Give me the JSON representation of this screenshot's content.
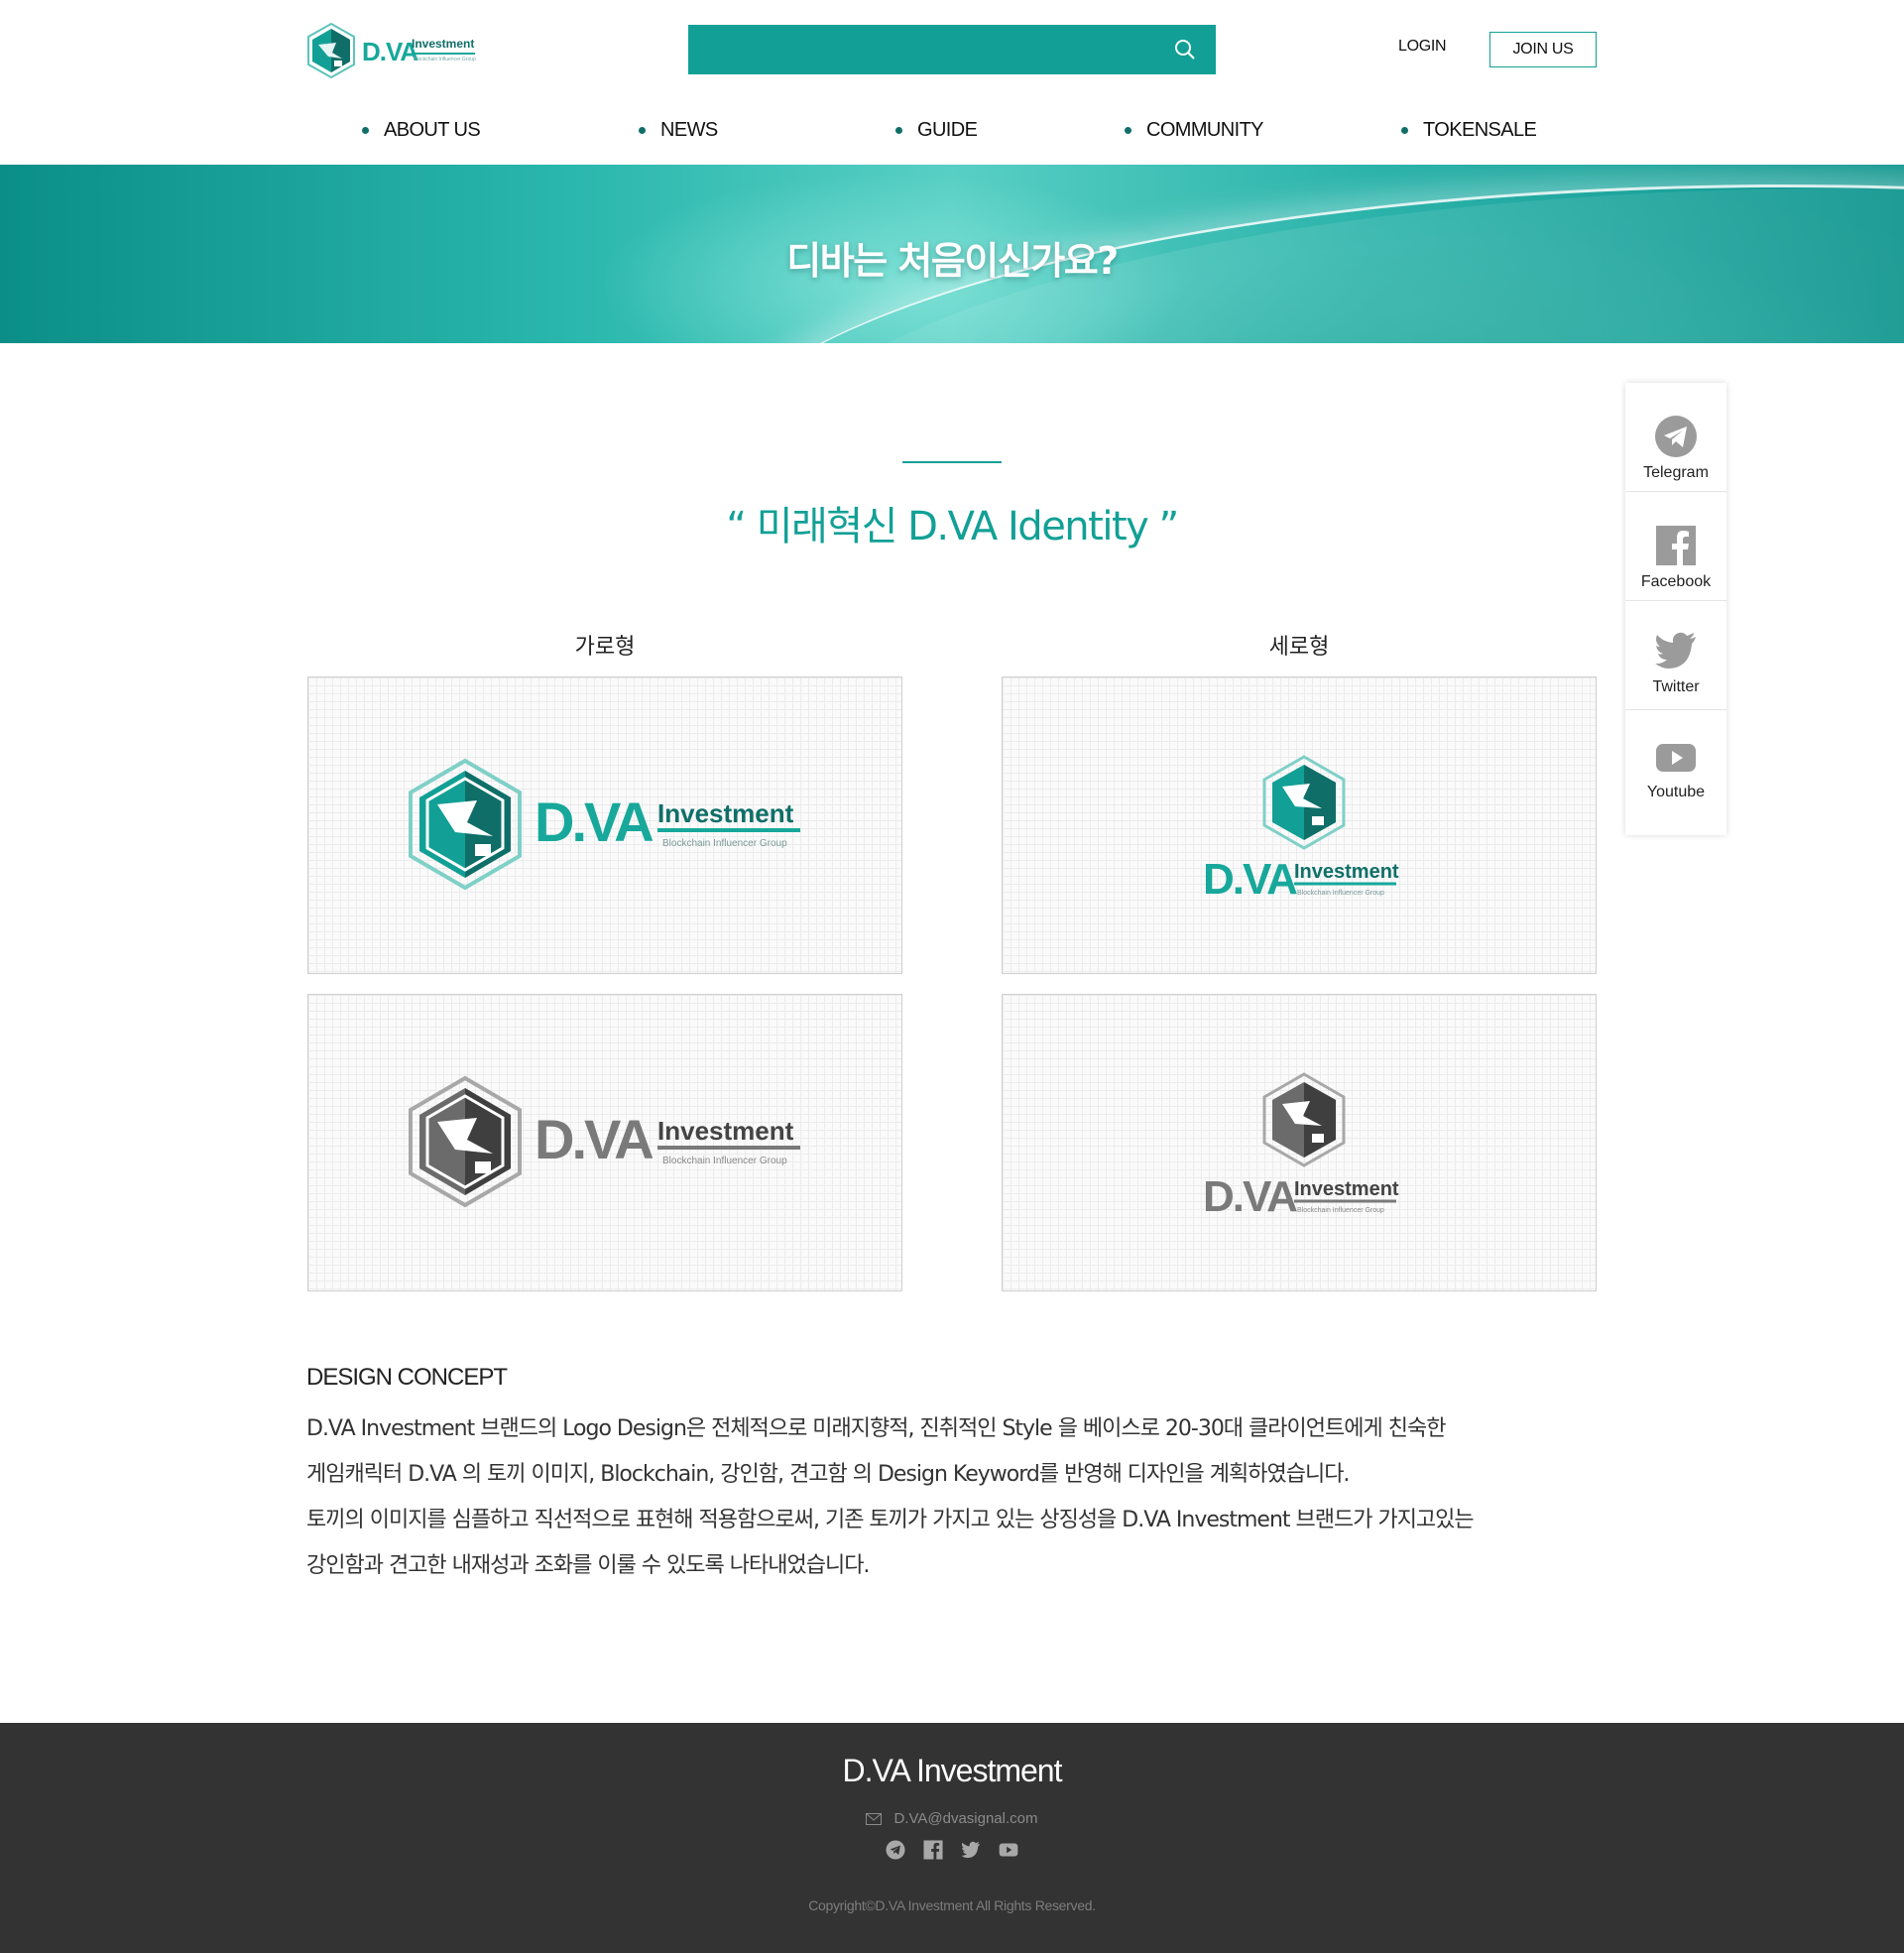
{
  "header": {
    "logo": {
      "brand": "D.VA",
      "product": "Investment",
      "tagline": "Blockchain Influencer Group"
    },
    "search": {
      "value": "",
      "placeholder": ""
    },
    "login_label": "LOGIN",
    "join_label": "JOIN US",
    "nav": [
      {
        "label": "ABOUT US"
      },
      {
        "label": "NEWS"
      },
      {
        "label": "GUIDE"
      },
      {
        "label": "COMMUNITY"
      },
      {
        "label": "TOKENSALE"
      }
    ]
  },
  "banner": {
    "title": "디바는 처음이신가요?"
  },
  "identity": {
    "title": "“ 미래혁신 D.VA Identity ”",
    "columns": [
      {
        "label": "가로형"
      },
      {
        "label": "세로형"
      }
    ],
    "logo_text": {
      "brand": "D.VA",
      "product": "Investment",
      "tagline": "Blockchain Influencer Group"
    }
  },
  "concept": {
    "title": "DESIGN CONCEPT",
    "lines": [
      "D.VA Investment 브랜드의 Logo Design은 전체적으로 미래지향적, 진취적인 Style 을 베이스로 20-30대 클라이언트에게 친숙한",
      "게임캐릭터 D.VA 의 토끼 이미지, Blockchain, 강인함, 견고함  의 Design Keyword를 반영해 디자인을 계획하였습니다.",
      "토끼의 이미지를 심플하고 직선적으로 표현해 적용함으로써, 기존 토끼가 가지고 있는 상징성을 D.VA Investment 브랜드가 가지고있는",
      "강인함과 견고한 내재성과 조화를 이룰 수 있도록 나타내었습니다."
    ]
  },
  "social": [
    {
      "label": "Telegram",
      "icon": "telegram-icon"
    },
    {
      "label": "Facebook",
      "icon": "facebook-icon"
    },
    {
      "label": "Twitter",
      "icon": "twitter-icon"
    },
    {
      "label": "Youtube",
      "icon": "youtube-icon"
    }
  ],
  "footer": {
    "title": "D.VA Investment",
    "email": "D.VA@dvasignal.com",
    "copyright": "Copyright©D.VA Investment All Rights Reserved."
  },
  "colors": {
    "accent": "#12a096",
    "accent_dark": "#0f6f68",
    "footer_bg": "#333333",
    "logo_gray": "#6b6b6b"
  }
}
